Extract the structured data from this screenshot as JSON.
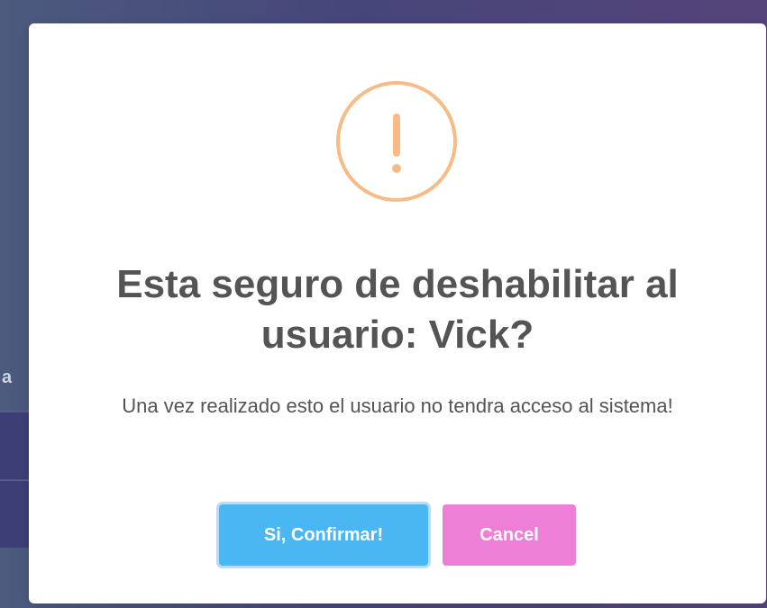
{
  "background": {
    "partial_text": "a"
  },
  "dialog": {
    "title": "Esta seguro de deshabilitar al usuario: Vick?",
    "message": "Una vez realizado esto el usuario no tendra acceso al sistema!",
    "icon": "warning-icon",
    "confirm_label": "Si, Confirmar!",
    "cancel_label": "Cancel"
  },
  "colors": {
    "warning": "#f8bb86",
    "confirm": "#4ab6f2",
    "cancel": "#ee7fd7",
    "text": "#545454"
  }
}
